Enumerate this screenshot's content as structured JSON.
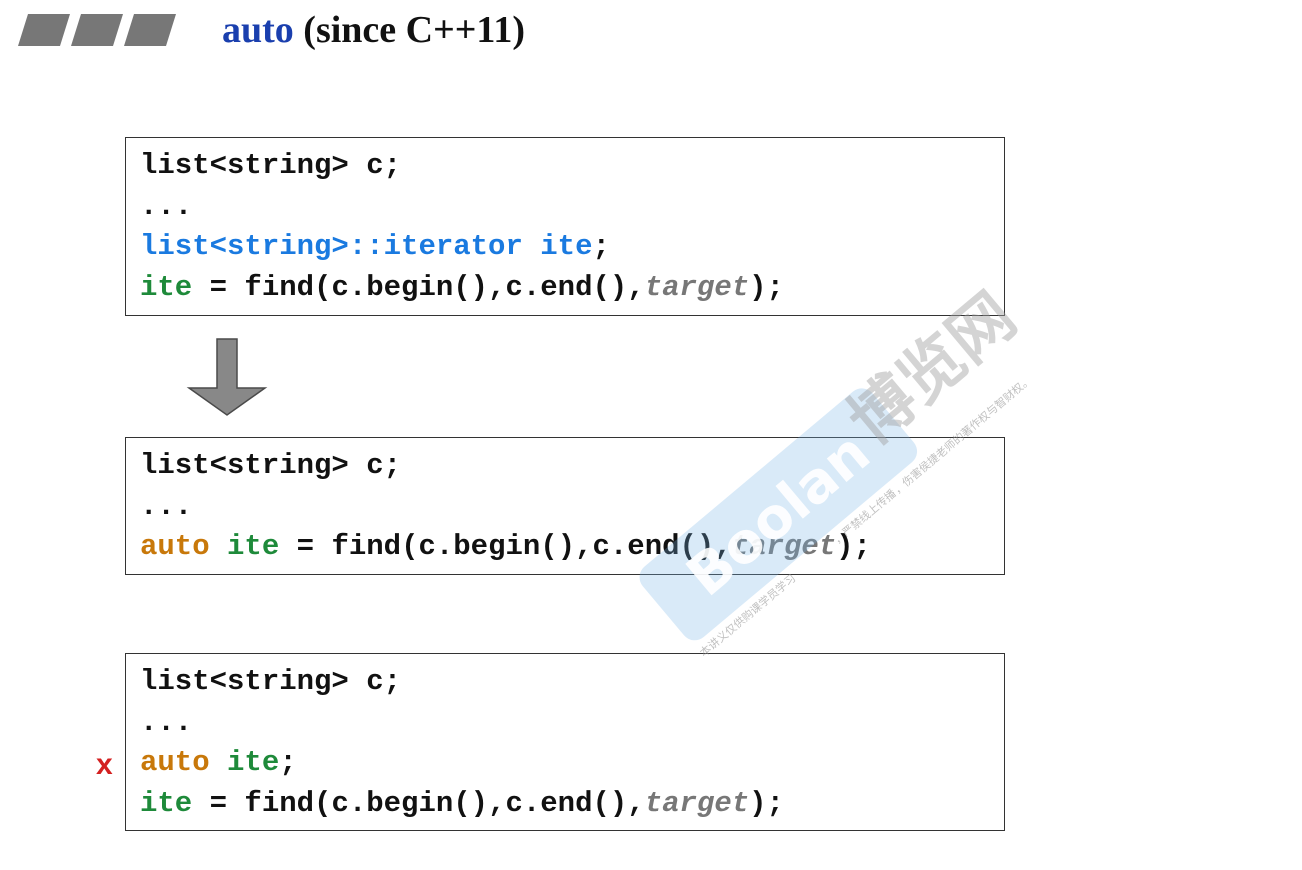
{
  "slide": {
    "title_keyword": "auto",
    "title_rest": " (since C++11)"
  },
  "code_blocks": [
    {
      "lines": [
        [
          {
            "t": "list<string> c;",
            "c": ""
          }
        ],
        [
          {
            "t": "...",
            "c": ""
          }
        ],
        [
          {
            "t": "list<string>::iterator ite",
            "c": "blue"
          },
          {
            "t": ";",
            "c": ""
          }
        ],
        [
          {
            "t": "ite",
            "c": "green"
          },
          {
            "t": " = find(c.begin(),c.end(),",
            "c": ""
          },
          {
            "t": "target",
            "c": "gray"
          },
          {
            "t": ");",
            "c": ""
          }
        ]
      ]
    },
    {
      "lines": [
        [
          {
            "t": "list<string> c;",
            "c": ""
          }
        ],
        [
          {
            "t": "...",
            "c": ""
          }
        ],
        [
          {
            "t": "auto",
            "c": "orange"
          },
          {
            "t": " ",
            "c": ""
          },
          {
            "t": "ite",
            "c": "green"
          },
          {
            "t": " = find(c.begin(),c.end(),",
            "c": ""
          },
          {
            "t": "target",
            "c": "gray"
          },
          {
            "t": ");",
            "c": ""
          }
        ]
      ]
    },
    {
      "lines": [
        [
          {
            "t": "list<string> c;",
            "c": ""
          }
        ],
        [
          {
            "t": "...",
            "c": ""
          }
        ],
        [
          {
            "t": "auto",
            "c": "orange"
          },
          {
            "t": " ",
            "c": ""
          },
          {
            "t": "ite",
            "c": "green"
          },
          {
            "t": ";",
            "c": ""
          }
        ],
        [
          {
            "t": "ite",
            "c": "green"
          },
          {
            "t": " = find(c.begin(),c.end(),",
            "c": ""
          },
          {
            "t": "target",
            "c": "gray"
          },
          {
            "t": ");",
            "c": ""
          }
        ]
      ]
    }
  ],
  "invalid_marker": "x",
  "watermark": {
    "brand": "Boolan",
    "chinese": "博览网",
    "fine_print_1": "本讲义仅供购课学员学习",
    "fine_print_2": "，严禁线上传播",
    "fine_print_3": "，伤害侯捷老师的著作权与智财权。"
  },
  "colors": {
    "title_keyword": "#1a3fae",
    "type_blue": "#1a7ae0",
    "identifier_green": "#1e8a3a",
    "keyword_orange": "#c8780a",
    "placeholder_gray": "#777777",
    "error_red": "#d42020"
  },
  "icons": {
    "header": "slanted-bars-icon",
    "arrow": "down-arrow-icon"
  }
}
